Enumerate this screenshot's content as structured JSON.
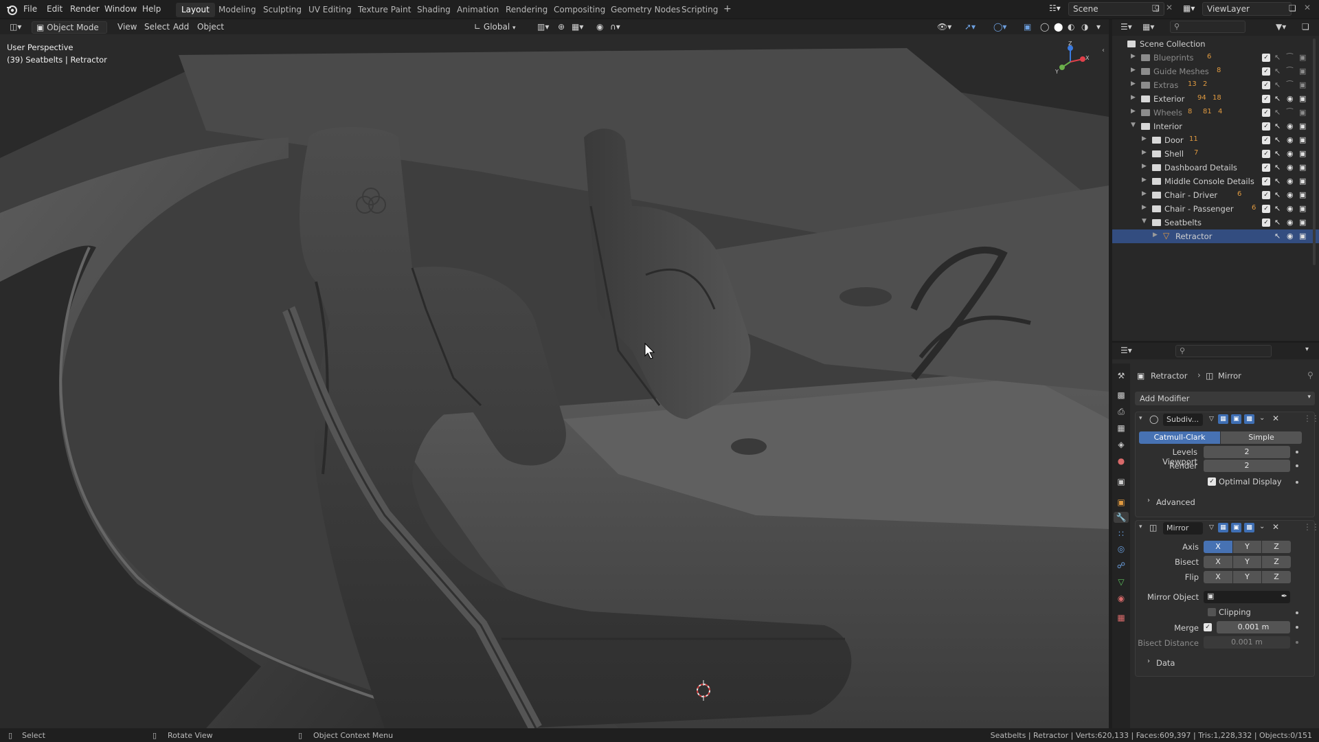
{
  "topbar": {
    "menus": [
      "File",
      "Edit",
      "Render",
      "Window",
      "Help"
    ],
    "workspaces": [
      "Layout",
      "Modeling",
      "Sculpting",
      "UV Editing",
      "Texture Paint",
      "Shading",
      "Animation",
      "Rendering",
      "Compositing",
      "Geometry Nodes",
      "Scripting"
    ],
    "active_workspace": "Layout",
    "add_tab": "+",
    "scene": "Scene",
    "view_layer": "ViewLayer"
  },
  "viewport_header": {
    "mode": "Object Mode",
    "menus": [
      "View",
      "Select",
      "Add",
      "Object"
    ],
    "orientation": "Global"
  },
  "viewport": {
    "perspective": "User Perspective",
    "object_info": "(39) Seatbelts | Retractor",
    "gizmo": {
      "x": "X",
      "y": "Y",
      "z": "Z"
    }
  },
  "outliner": {
    "root": "Scene Collection",
    "rows": [
      {
        "label": "Blueprints",
        "depth": 0,
        "expanded": false,
        "dim": true,
        "count": "6"
      },
      {
        "label": "Guide Meshes",
        "depth": 0,
        "expanded": false,
        "dim": true,
        "count": "8"
      },
      {
        "label": "Extras",
        "depth": 0,
        "expanded": false,
        "dim": true,
        "count": "13",
        "count2": "2"
      },
      {
        "label": "Exterior",
        "depth": 0,
        "expanded": false,
        "dim": false,
        "count": "94",
        "count2": "18"
      },
      {
        "label": "Wheels",
        "depth": 0,
        "expanded": false,
        "dim": true,
        "count": "8",
        "count2": "81",
        "count3": "4"
      },
      {
        "label": "Interior",
        "depth": 0,
        "expanded": true,
        "dim": false
      },
      {
        "label": "Door",
        "depth": 1,
        "expanded": false,
        "dim": false,
        "count": "11"
      },
      {
        "label": "Shell",
        "depth": 1,
        "expanded": false,
        "dim": false,
        "count": "7"
      },
      {
        "label": "Dashboard Details",
        "depth": 1,
        "expanded": false,
        "dim": false
      },
      {
        "label": "Middle Console Details",
        "depth": 1,
        "expanded": false,
        "dim": false
      },
      {
        "label": "Chair - Driver",
        "depth": 1,
        "expanded": false,
        "dim": false,
        "count": "6"
      },
      {
        "label": "Chair - Passenger",
        "depth": 1,
        "expanded": false,
        "dim": false,
        "count": "6"
      },
      {
        "label": "Seatbelts",
        "depth": 1,
        "expanded": true,
        "dim": false
      },
      {
        "label": "Retractor",
        "depth": 2,
        "expanded": false,
        "dim": false,
        "object": true
      }
    ]
  },
  "properties": {
    "breadcrumb_object": "Retractor",
    "breadcrumb_modifier": "Mirror",
    "add_modifier": "Add Modifier",
    "subdiv": {
      "name": "Subdiv...",
      "types": [
        "Catmull-Clark",
        "Simple"
      ],
      "active_type": "Catmull-Clark",
      "levels_viewport_label": "Levels Viewport",
      "levels_viewport": "2",
      "render_label": "Render",
      "render": "2",
      "optimal_display": "Optimal Display",
      "advanced": "Advanced"
    },
    "mirror": {
      "name": "Mirror",
      "axis_label": "Axis",
      "bisect_label": "Bisect",
      "flip_label": "Flip",
      "axes": [
        "X",
        "Y",
        "Z"
      ],
      "mirror_object_label": "Mirror Object",
      "clipping": "Clipping",
      "merge_label": "Merge",
      "merge_value": "0.001 m",
      "bisect_distance_label": "Bisect Distance",
      "bisect_distance_value": "0.001 m",
      "data": "Data"
    }
  },
  "statusbar": {
    "select": "Select",
    "rotate": "Rotate View",
    "context": "Object Context Menu",
    "stats": "Seatbelts | Retractor | Verts:620,133 | Faces:609,397 | Tris:1,228,332 | Objects:0/151"
  },
  "colors": {
    "accent": "#4772b3",
    "panel_bg": "#2b2b2b",
    "viewport_bg": "#3b3b3b"
  }
}
